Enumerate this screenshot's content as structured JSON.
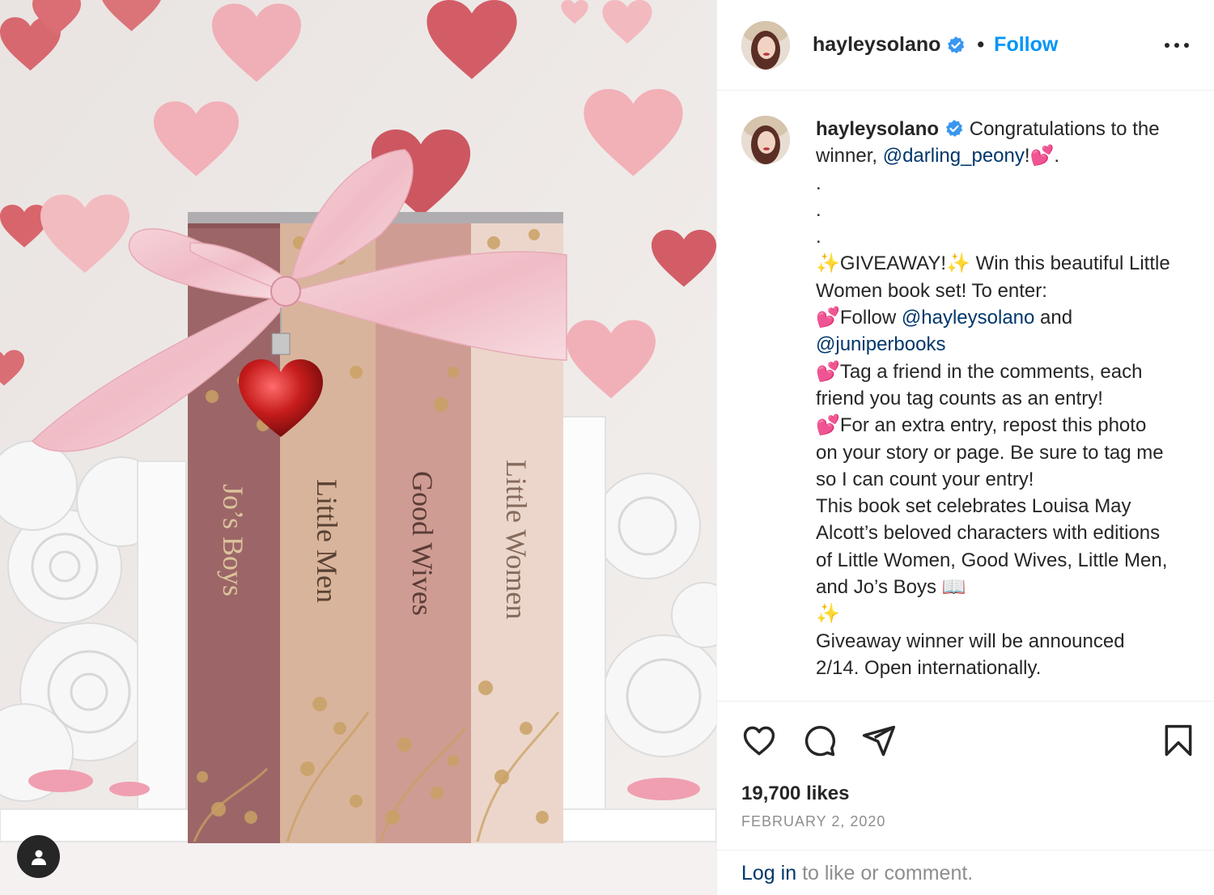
{
  "post": {
    "username": "hayleysolano",
    "follow_label": "Follow",
    "separator": "•",
    "likes": "19,700 likes",
    "date": "FEBRUARY 2, 2020"
  },
  "caption": {
    "username": "hayleysolano",
    "line1_text": " Congratulations to the winner, ",
    "line1_mention": "@darling_peony",
    "line1_end": "!💕.",
    "dots": ".\n.\n.",
    "giveaway_a": "✨GIVEAWAY!✨ Win this beautiful Little Women book set! To enter:\n💕Follow ",
    "mention_hayley": "@hayleysolano",
    "giveaway_b": " and ",
    "mention_juniper": "@juniperbooks",
    "giveaway_c": "\n💕Tag a friend in the comments, each friend you tag counts as an entry!\n💕For an extra entry, repost this photo on your story or page. Be sure to tag me so I can count your entry!\nThis book set celebrates Louisa May Alcott’s beloved characters with editions of Little Women, Good Wives, Little Men, and Jo’s Boys 📖\n✨\nGiveaway winner will be announced 2/14. Open internationally."
  },
  "footer": {
    "login_link": "Log in",
    "login_rest": " to like or comment."
  },
  "photo": {
    "book_titles": [
      "Jo’s Boys",
      "Little Men",
      "Good Wives",
      "Little Women"
    ]
  },
  "icons": [
    "verified-badge-icon",
    "more-options-icon",
    "heart-icon",
    "comment-icon",
    "share-icon",
    "bookmark-icon",
    "user-tag-icon"
  ],
  "colors": {
    "accent": "#0095f6",
    "mention": "#00376b",
    "muted": "#8e8e8e",
    "verified": "#3897f0"
  }
}
